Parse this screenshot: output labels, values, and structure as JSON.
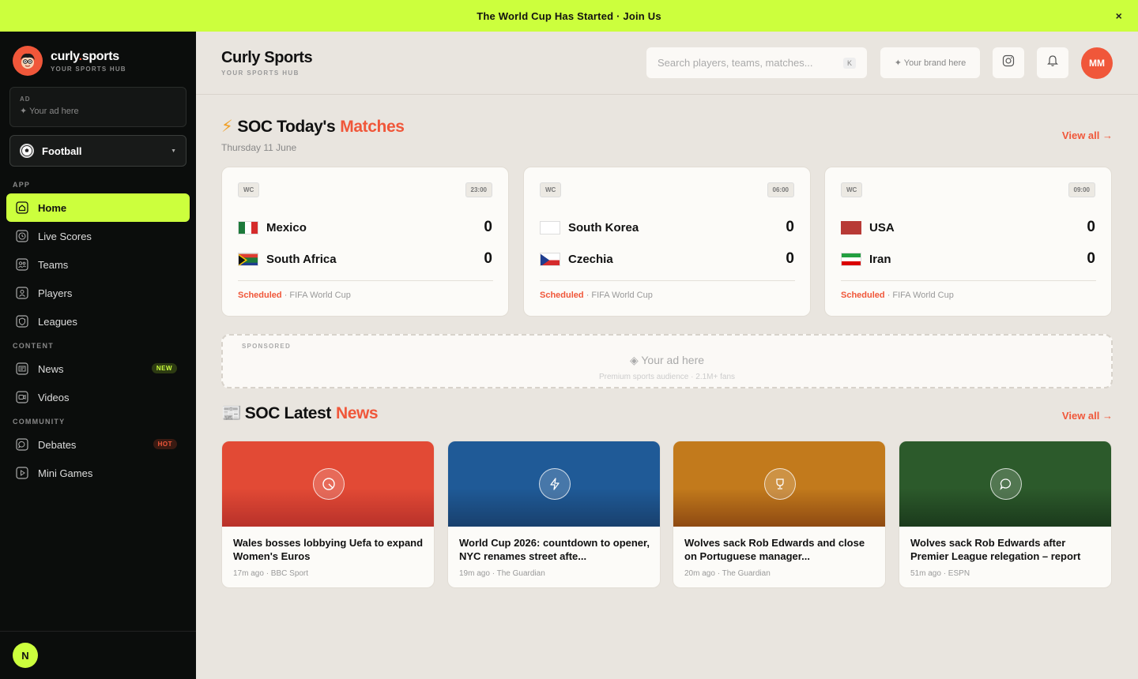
{
  "banner": {
    "text": "The World Cup Has Started · Join Us",
    "close": "×"
  },
  "sidebar": {
    "logo_name_a": "curly",
    "logo_name_dot": ".",
    "logo_name_b": "sports",
    "logo_sub": "YOUR SPORTS HUB",
    "ad_label": "AD",
    "ad_text": "✦ Your ad here",
    "sport": "Football",
    "sections": {
      "app": "APP",
      "content": "CONTENT",
      "community": "COMMUNITY"
    },
    "items": [
      {
        "label": "Home",
        "icon": "home-icon",
        "active": true
      },
      {
        "label": "Live Scores",
        "icon": "clock-icon"
      },
      {
        "label": "Teams",
        "icon": "users-icon"
      },
      {
        "label": "Players",
        "icon": "user-icon"
      },
      {
        "label": "Leagues",
        "icon": "shield-icon"
      },
      {
        "label": "News",
        "icon": "newspaper-icon",
        "badge": "NEW"
      },
      {
        "label": "Videos",
        "icon": "video-icon"
      },
      {
        "label": "Debates",
        "icon": "chat-icon",
        "badge": "HOT"
      },
      {
        "label": "Mini Games",
        "icon": "play-icon"
      }
    ],
    "user_initial": "N"
  },
  "header": {
    "title": "Curly Sports",
    "subtitle": "YOUR SPORTS HUB",
    "search_placeholder": "Search players, teams, matches...",
    "search_kbd": "K",
    "brand_btn": "✦ Your brand here",
    "avatar": "MM"
  },
  "matches_section": {
    "emoji": "⚡",
    "title_a": "SOC Today's",
    "title_b": "Matches",
    "date": "Thursday 11 June",
    "view_all": "View all →"
  },
  "matches": [
    {
      "tag": "WC",
      "time": "23:00",
      "home": {
        "name": "Mexico",
        "score": "0"
      },
      "away": {
        "name": "South Africa",
        "score": "0"
      },
      "status": "Scheduled",
      "competition": "· FIFA World Cup"
    },
    {
      "tag": "WC",
      "time": "06:00",
      "home": {
        "name": "South Korea",
        "score": "0"
      },
      "away": {
        "name": "Czechia",
        "score": "0"
      },
      "status": "Scheduled",
      "competition": "· FIFA World Cup"
    },
    {
      "tag": "WC",
      "time": "09:00",
      "home": {
        "name": "USA",
        "score": "0"
      },
      "away": {
        "name": "Iran",
        "score": "0"
      },
      "status": "Scheduled",
      "competition": "· FIFA World Cup"
    }
  ],
  "sponsored": {
    "label": "SPONSORED",
    "title": "◈ Your ad here",
    "sub": "Premium sports audience · 2.1M+ fans"
  },
  "news_section": {
    "emoji": "📰",
    "title_a": "SOC Latest",
    "title_b": "News",
    "view_all": "View all →"
  },
  "news": [
    {
      "title": "Wales bosses lobbying Uefa to expand Women's Euros",
      "meta": "17m ago · BBC Sport",
      "color_top": "#e24a35",
      "color_bottom": "#b8312a",
      "icon": "ball-icon"
    },
    {
      "title": "World Cup 2026: countdown to opener, NYC renames street afte...",
      "meta": "19m ago · The Guardian",
      "color_top": "#1f5a97",
      "color_bottom": "#18406d",
      "icon": "lightning-icon"
    },
    {
      "title": "Wolves sack Rob Edwards and close on Portuguese manager...",
      "meta": "20m ago · The Guardian",
      "color_top": "#c27a1c",
      "color_bottom": "#8e4a12",
      "icon": "trophy-icon"
    },
    {
      "title": "Wolves sack Rob Edwards after Premier League relegation – report",
      "meta": "51m ago · ESPN",
      "color_top": "#2c5a2b",
      "color_bottom": "#1b3a1c",
      "icon": "chat-icon"
    }
  ],
  "colors": {
    "accent": "#f0573a",
    "lime": "#ccff3d",
    "sidebar": "#0b0d0c",
    "bg": "#e9e5df"
  }
}
